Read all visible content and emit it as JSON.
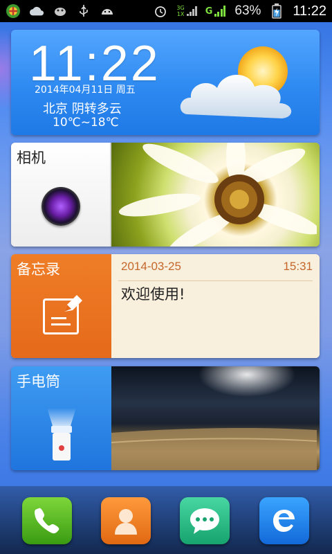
{
  "status_bar": {
    "battery_percent": "63%",
    "time": "11:22",
    "network_type": "G",
    "network_labels": [
      "3G",
      "1X"
    ],
    "icons": [
      "app-badge-icon",
      "cloud-icon",
      "bird-icon",
      "usb-icon",
      "android-icon",
      "alarm-icon",
      "signal-icon",
      "battery-charging-icon"
    ]
  },
  "clock_widget": {
    "time": "11:22",
    "date": "2014年04月11日 周五",
    "city_weather": "北京 阴转多云",
    "temperature": "10℃~18℃",
    "weather_icon": "partly-cloudy-icon"
  },
  "camera_widget": {
    "label": "相机",
    "icon": "camera-lens-icon"
  },
  "memo_widget": {
    "label": "备忘录",
    "date": "2014-03-25",
    "time": "15:31",
    "content": "欢迎使用!",
    "icon": "memo-edit-icon"
  },
  "flashlight_widget": {
    "label": "手电筒",
    "icon": "flashlight-icon"
  },
  "dock": {
    "items": [
      {
        "name": "phone",
        "icon": "phone-icon"
      },
      {
        "name": "contacts",
        "icon": "contacts-icon"
      },
      {
        "name": "messages",
        "icon": "message-icon"
      },
      {
        "name": "browser",
        "icon": "browser-icon"
      }
    ]
  },
  "colors": {
    "memo_accent": "#e56a1a",
    "memo_text": "#c5672a",
    "flash_accent": "#1f75dd",
    "clock_bg": "#2e8af1"
  }
}
